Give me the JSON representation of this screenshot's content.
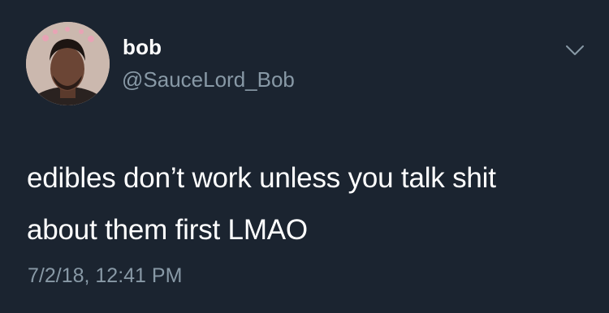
{
  "author": {
    "display_name": "bob",
    "handle": "@SauceLord_Bob",
    "avatar_icon": "avatar-photo"
  },
  "menu": {
    "icon": "chevron-down-icon"
  },
  "tweet": {
    "text_lines": [
      "edibles don’t work unless you talk shit",
      "about them first LMAO"
    ],
    "timestamp": "7/2/18, 12:41 PM"
  },
  "colors": {
    "background": "#1b2430",
    "primary_text": "#ffffff",
    "secondary_text": "#8899a6"
  }
}
